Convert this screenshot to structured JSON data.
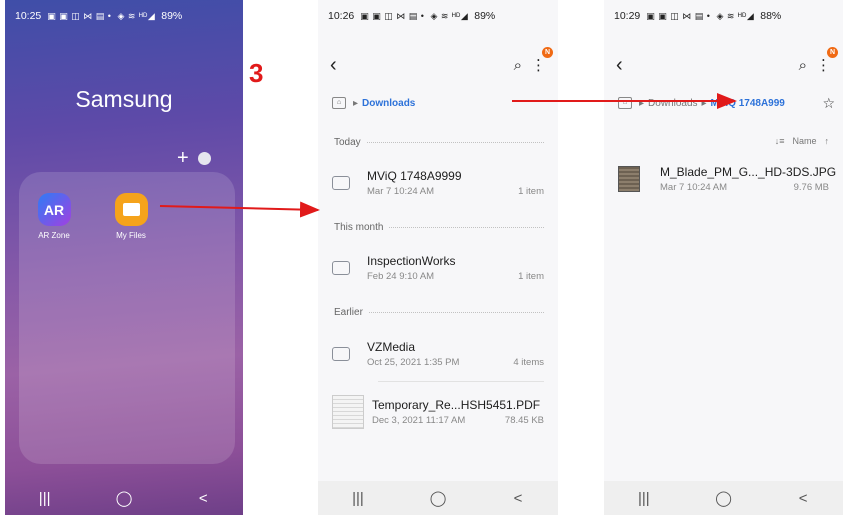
{
  "step_number": "3",
  "screen_home": {
    "status": {
      "time": "10:25",
      "notifications": "▣ ▣ ◫ ⋈ ▤ •",
      "signal": "◈ ≋ ᴴᴰ◢",
      "battery": "89%"
    },
    "title": "Samsung",
    "plus": "+",
    "apps": [
      {
        "label": "AR Zone",
        "icon_text": "AR",
        "icon": "ar-zone-icon",
        "color": "#5b5ee8"
      },
      {
        "label": "My Files",
        "icon": "my-files-icon",
        "color": "#f5a31b"
      }
    ],
    "nav": {
      "recents": "|||",
      "home": "◯",
      "back": "<"
    }
  },
  "screen_downloads": {
    "status": {
      "time": "10:26",
      "notifications": "▣ ▣ ◫ ⋈ ▤ •",
      "signal": "◈ ≋ ᴴᴰ◢",
      "battery": "89%"
    },
    "badge": "N",
    "breadcrumb": {
      "home": "⌂",
      "separator": "▸",
      "current": "Downloads"
    },
    "sections": [
      {
        "label": "Today"
      },
      {
        "label": "This month"
      },
      {
        "label": "Earlier"
      }
    ],
    "items": [
      {
        "name": "MViQ 1748A9999",
        "date": "Mar 7 10:24 AM",
        "meta": "1 item",
        "type": "folder"
      },
      {
        "name": "InspectionWorks",
        "date": "Feb 24 9:10 AM",
        "meta": "1 item",
        "type": "folder"
      },
      {
        "name": "VZMedia",
        "date": "Oct 25, 2021 1:35 PM",
        "meta": "4 items",
        "type": "folder"
      },
      {
        "name": "Temporary_Re...HSH5451.PDF",
        "date": "Dec 3, 2021 11:17 AM",
        "meta": "78.45 KB",
        "type": "pdf"
      }
    ],
    "nav": {
      "recents": "|||",
      "home": "◯",
      "back": "<"
    }
  },
  "screen_folder": {
    "status": {
      "time": "10:29",
      "notifications": "▣ ▣ ◫ ⋈ ▤ •",
      "signal": "◈ ≋ ᴴᴰ◢",
      "battery": "88%"
    },
    "badge": "N",
    "breadcrumb": {
      "home": "⌂",
      "separator": "▸",
      "parent": "Downloads",
      "current": "MViQ 1748A999"
    },
    "sort": {
      "icon": "↓≡",
      "label": "Name",
      "direction": "↑"
    },
    "items": [
      {
        "name": "M_Blade_PM_G..._HD-3DS.JPG",
        "date": "Mar 7 10:24 AM",
        "meta": "9.76 MB",
        "type": "image"
      }
    ],
    "nav": {
      "recents": "|||",
      "home": "◯",
      "back": "<"
    }
  },
  "colors": {
    "arrow": "#e11a1a",
    "link": "#2d72d9",
    "badge": "#f06a14"
  }
}
